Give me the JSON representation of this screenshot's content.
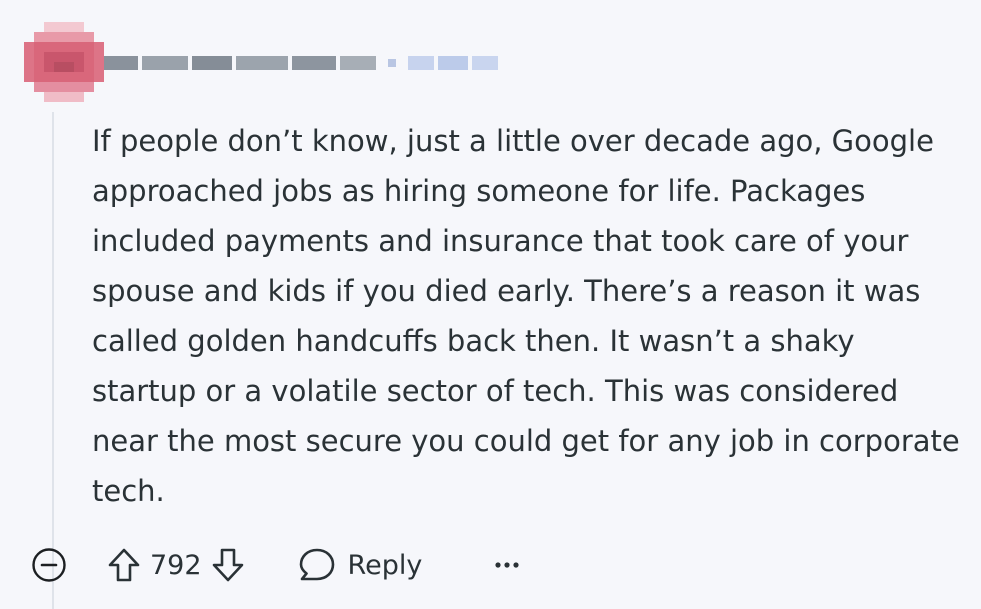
{
  "comment": {
    "body": "If people don’t know, just a little over decade ago, Google approached jobs as hiring someone for life. Packages included payments and insurance that took care of your spouse and kids if you died early. There’s a reason it was called golden handcuffs back then. It wasn’t a shaky startup or a volatile sector of tech. This was considered near the most secure you could get for any job in corporate tech."
  },
  "actions": {
    "score": "792",
    "reply_label": "Reply"
  },
  "icons": {
    "avatar": "avatar-pixelated",
    "collapse": "collapse-minus-icon",
    "upvote": "upvote-arrow-icon",
    "downvote": "downvote-arrow-icon",
    "reply": "comment-bubble-icon",
    "more": "more-dots-icon"
  },
  "colors": {
    "background": "#f6f7fb",
    "text": "#2a3236",
    "avatar": "#d9677b",
    "thread_line": "#dfe3ea"
  }
}
